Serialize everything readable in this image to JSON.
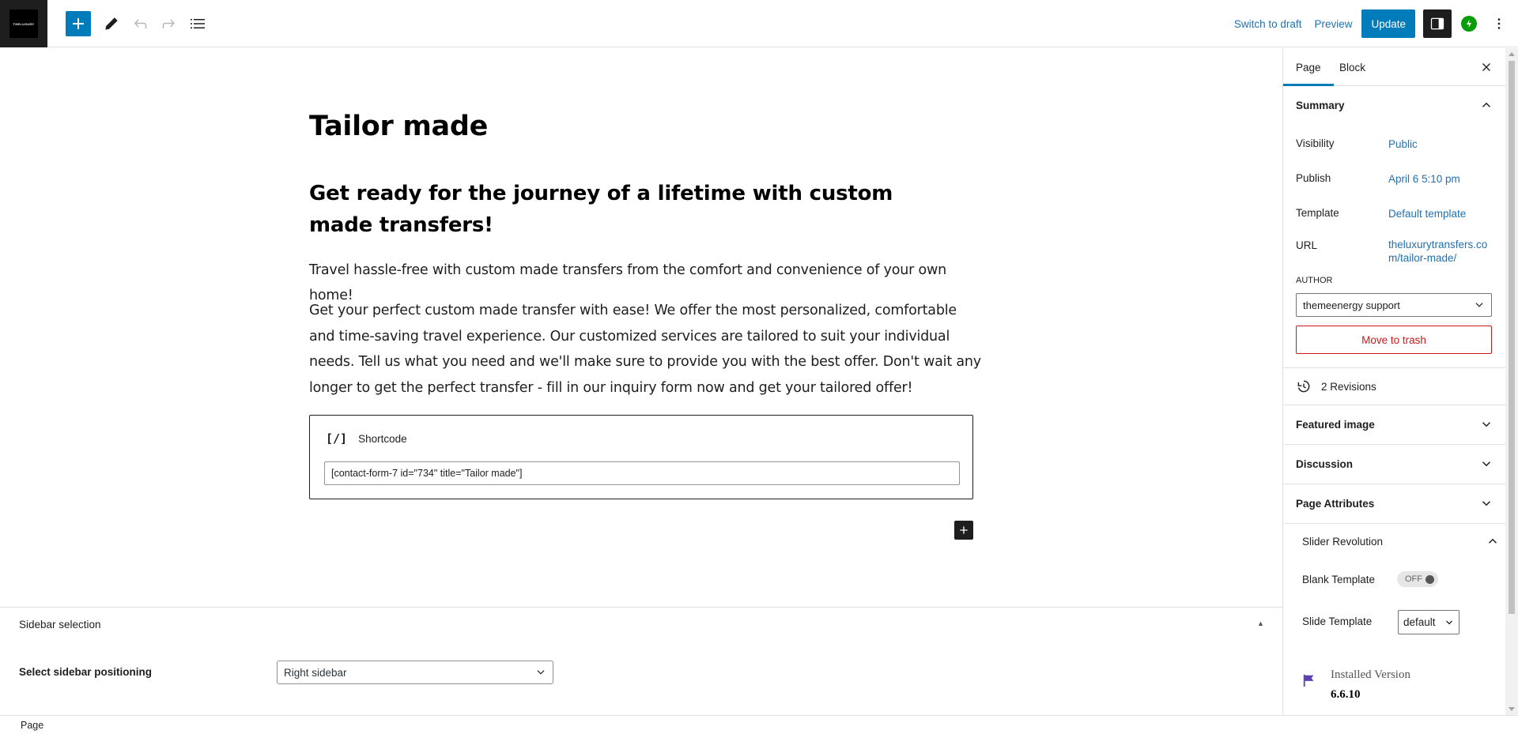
{
  "toolbar": {
    "logo_text": "THELUXURY",
    "switch_to_draft": "Switch to draft",
    "preview": "Preview",
    "update": "Update"
  },
  "post": {
    "title": "Tailor made",
    "heading": "Get ready for the journey of a lifetime with custom made transfers!",
    "paragraph1": "Travel hassle-free with custom made transfers from the comfort and convenience of your own home!",
    "paragraph2": "Get your perfect custom made transfer with ease! We offer the most personalized, comfortable and time-saving travel experience. Our customized services are tailored to suit your individual needs. Tell us what you need and we'll make sure to provide you with the best offer. Don't wait any longer to get the perfect transfer - fill in our inquiry form now and get your tailored offer!",
    "shortcode_icon": "[/]",
    "shortcode_label": "Shortcode",
    "shortcode_value": "[contact-form-7 id=\"734\" title=\"Tailor made\"]"
  },
  "metabox": {
    "title": "Sidebar selection",
    "sidebar_position_label": "Select sidebar positioning",
    "sidebar_position_value": "Right sidebar"
  },
  "footer": {
    "breadcrumb": "Page"
  },
  "sidebar": {
    "tabs": [
      {
        "label": "Page"
      },
      {
        "label": "Block"
      }
    ],
    "summary": {
      "title": "Summary",
      "visibility_label": "Visibility",
      "visibility_value": "Public",
      "publish_label": "Publish",
      "publish_value": "April 6 5:10 pm",
      "template_label": "Template",
      "template_value": "Default template",
      "url_label": "URL",
      "url_value_line1": "theluxurytransfers.co",
      "url_value_line2": "m/tailor-made/",
      "author_label": "AUTHOR",
      "author_value": "themeenergy support",
      "trash_label": "Move to trash"
    },
    "revisions_label": "2 Revisions",
    "panels": [
      {
        "label": "Featured image"
      },
      {
        "label": "Discussion"
      },
      {
        "label": "Page Attributes"
      }
    ],
    "slider_revolution": {
      "title": "Slider Revolution",
      "blank_template_label": "Blank Template",
      "blank_template_toggle": "OFF",
      "slide_template_label": "Slide Template",
      "slide_template_value": "default",
      "installed_label": "Installed Version",
      "installed_version": "6.6.10"
    }
  },
  "colors": {
    "accent": "#007cba",
    "link": "#2271b1",
    "danger": "#cc1818",
    "dark": "#1e1e1e",
    "jetpack": "#069e08"
  }
}
